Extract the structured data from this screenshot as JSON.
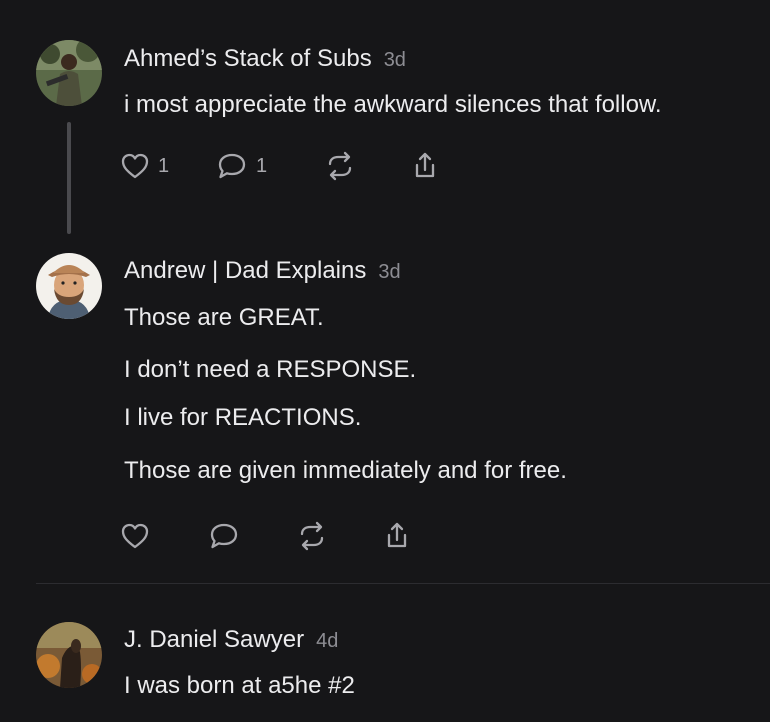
{
  "comments": [
    {
      "author": "Ahmed’s Stack of Subs",
      "time": "3d",
      "lines": [
        "i most appreciate the awkward silences that follow."
      ],
      "like_count": "1",
      "reply_count": "1"
    },
    {
      "author": "Andrew | Dad Explains",
      "time": "3d",
      "lines": [
        "Those are GREAT.",
        "I don’t need a RESPONSE.",
        "I live for REACTIONS.",
        "Those are given immediately and for free."
      ]
    },
    {
      "author": "J. Daniel Sawyer",
      "time": "4d",
      "lines": [
        "I was born at a5he #2"
      ]
    }
  ],
  "icons": {
    "like": "heart-icon",
    "reply": "speech-bubble-icon",
    "restack": "restack-icon",
    "share": "share-icon"
  },
  "colors": {
    "background": "#161618",
    "text": "#ececee",
    "muted": "#8d8d93",
    "icon": "#a8a8ad",
    "thread_line": "#4a4a4e"
  }
}
